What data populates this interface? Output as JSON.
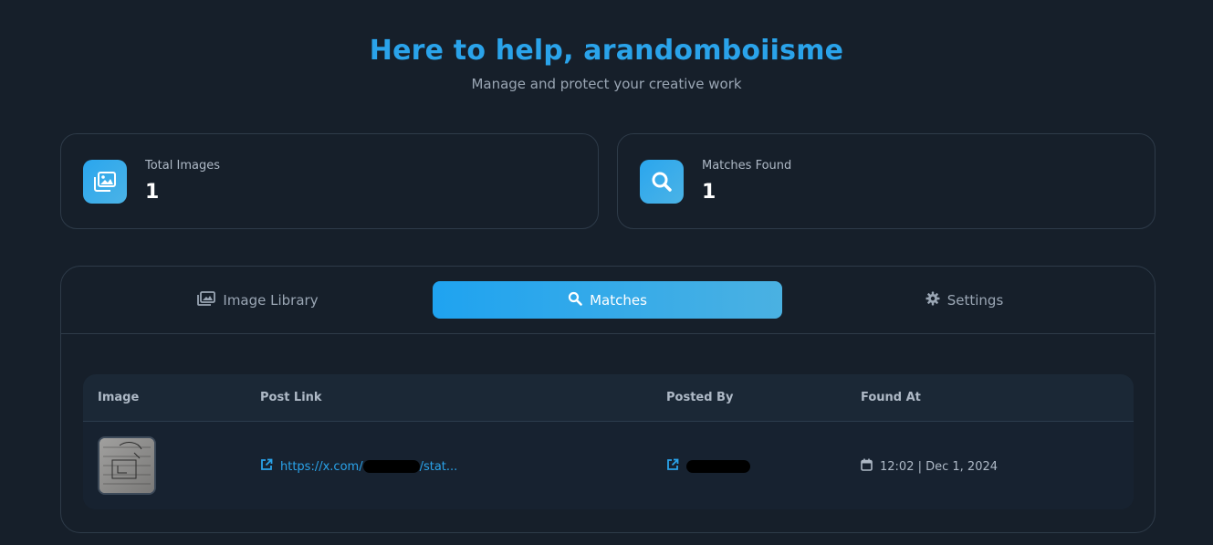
{
  "header": {
    "title": "Here to help, arandomboiisme",
    "subtitle": "Manage and protect your creative work"
  },
  "stats": [
    {
      "label": "Total Images",
      "value": "1",
      "icon": "images-icon"
    },
    {
      "label": "Matches Found",
      "value": "1",
      "icon": "search-icon"
    }
  ],
  "tabs": [
    {
      "label": "Image Library",
      "icon": "image-library-icon",
      "active": false
    },
    {
      "label": "Matches",
      "icon": "search-icon",
      "active": true
    },
    {
      "label": "Settings",
      "icon": "gear-icon",
      "active": false
    }
  ],
  "table": {
    "columns": [
      "Image",
      "Post Link",
      "Posted By",
      "Found At"
    ],
    "rows": [
      {
        "post_link_prefix": "https://x.com/",
        "post_link_suffix": "/stat...",
        "found_at": "12:02 | Dec 1, 2024"
      }
    ]
  },
  "colors": {
    "accent": "#2aa3ea",
    "background": "#161f2a",
    "card_border": "#2e3b49"
  }
}
